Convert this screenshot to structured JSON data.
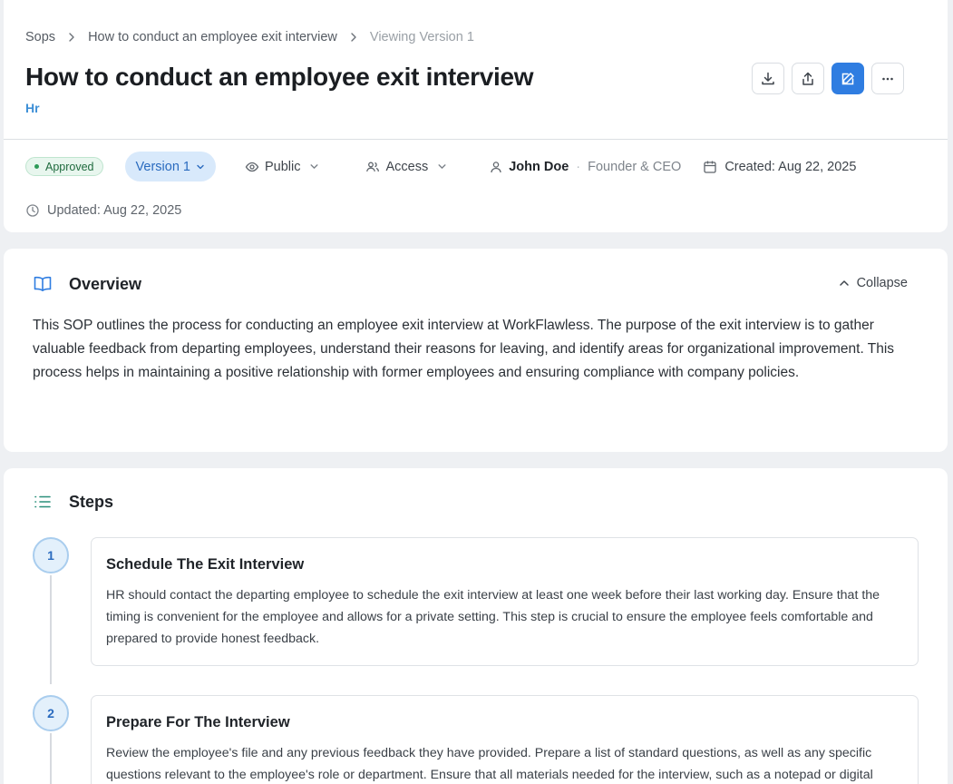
{
  "breadcrumb": {
    "root": "Sops",
    "parent": "How to conduct an employee exit interview",
    "current": "Viewing Version 1"
  },
  "page": {
    "title": "How to conduct an employee exit interview",
    "department": "Hr"
  },
  "actions": {
    "download_icon": "download-icon",
    "share_icon": "share-icon",
    "edit_icon": "edit-icon",
    "more_icon": "more-icon"
  },
  "meta": {
    "status": "Approved",
    "version": "Version 1",
    "visibility": "Public",
    "access": "Access",
    "author": "John Doe",
    "separator": "·",
    "author_role": "Founder & CEO",
    "created": "Created: Aug 22, 2025",
    "updated": "Updated: Aug 22, 2025"
  },
  "overview": {
    "title": "Overview",
    "collapse_label": "Collapse",
    "text": "This SOP outlines the process for conducting an employee exit interview at WorkFlawless. The purpose of the exit interview is to gather valuable feedback from departing employees, understand their reasons for leaving, and identify areas for organizational improvement. This process helps in maintaining a positive relationship with former employees and ensuring compliance with company policies."
  },
  "steps": {
    "title": "Steps",
    "items": [
      {
        "number": "1",
        "title": "Schedule The Exit Interview",
        "description": "HR should contact the departing employee to schedule the exit interview at least one week before their last working day. Ensure that the timing is convenient for the employee and allows for a private setting. This step is crucial to ensure the employee feels comfortable and prepared to provide honest feedback."
      },
      {
        "number": "2",
        "title": "Prepare For The Interview",
        "description": "Review the employee's file and any previous feedback they have provided. Prepare a list of standard questions, as well as any specific questions relevant to the employee's role or department. Ensure that all materials needed for the interview, such as a notepad or digital"
      }
    ]
  },
  "colors": {
    "accent": "#2f7de1",
    "approved": "#2e9a58",
    "link": "#3d8fd6"
  }
}
